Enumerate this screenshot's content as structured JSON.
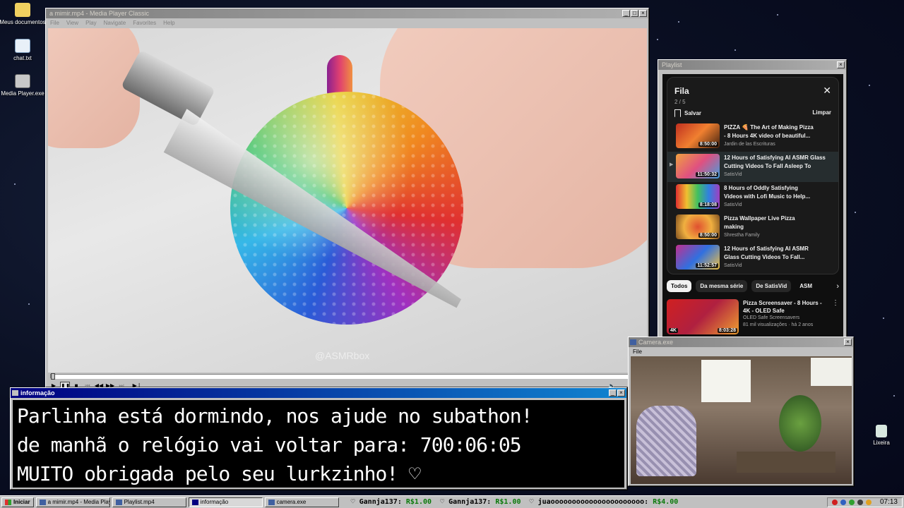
{
  "desktop": {
    "icons": [
      {
        "label": "Meus documentos"
      },
      {
        "label": "chat.txt"
      },
      {
        "label": "Media Player.exe"
      },
      {
        "label": "Lixeira"
      }
    ]
  },
  "media_player": {
    "title": "a mimir.mp4 - Media Player Classic",
    "menu": [
      "File",
      "View",
      "Play",
      "Navigate",
      "Favorites",
      "Help"
    ],
    "watermark": "@ASMRbox",
    "playback_position": 0.0
  },
  "playlist_window": {
    "title": "Playlist",
    "queue": {
      "title": "Fila",
      "count": "2 / 5",
      "save_label": "Salvar",
      "clear_label": "Limpar",
      "items": [
        {
          "title_line1": "PIZZA 🍕 The Art of Making Pizza",
          "title_line2": "- 8 Hours 4K video of beautiful...",
          "channel": "Jardin de las Escrituras",
          "duration": "8:50:00",
          "current": false
        },
        {
          "title_line1": "12 Hours of Satisfying AI ASMR Glass",
          "title_line2": "Cutting Videos To Fall Asleep To",
          "channel": "SatisVid",
          "duration": "11:50:32",
          "current": true
        },
        {
          "title_line1": "8 Hours of Oddly Satisfying",
          "title_line2": "Videos with Lofi Music to Help...",
          "channel": "SatisVid",
          "duration": "8:18:08",
          "current": false
        },
        {
          "title_line1": "Pizza Wallpaper Live Pizza",
          "title_line2": "making",
          "channel": "Shrestha Family",
          "duration": "8:50:00",
          "current": false
        },
        {
          "title_line1": "12 Hours of Satisfying AI ASMR",
          "title_line2": "Glass Cutting Videos To Fall...",
          "channel": "SatisVid",
          "duration": "11:52:57",
          "current": false
        }
      ]
    },
    "chips": [
      "Todos",
      "Da mesma série",
      "De SatisVid",
      "ASM"
    ],
    "recommended": {
      "title_line1": "Pizza Screensaver - 8 Hours -",
      "title_line2": "4K - OLED Safe",
      "channel": "OLED Safe Screensavers",
      "meta": "81 mil visualizações · há 2 anos",
      "duration": "8:03:28",
      "badge": "4K"
    }
  },
  "info_window": {
    "title": "informação",
    "lines": [
      "Parlinha está dormindo, nos ajude no subathon!",
      "de manhã o relógio vai voltar para:  700:06:05",
      "MUITO obrigada pelo seu lurkzinho! ♡"
    ]
  },
  "camera_window": {
    "title": "Camera.exe",
    "menu": [
      "File"
    ]
  },
  "taskbar": {
    "start_label": "Iniciar",
    "tasks": [
      {
        "label": "a mimir.mp4 - Media Playe...",
        "pressed": false
      },
      {
        "label": "Playlist.mp4",
        "pressed": false
      },
      {
        "label": "informação",
        "pressed": true
      },
      {
        "label": "camera.exe",
        "pressed": false
      }
    ],
    "ticker": [
      {
        "user": "Gannja137:",
        "amount": "R$1.00"
      },
      {
        "user": "Gannja137:",
        "amount": "R$1.00"
      },
      {
        "user": "juaoooooooooooooooooooooo:",
        "amount": "R$4.00"
      }
    ],
    "clock": "07:13"
  }
}
